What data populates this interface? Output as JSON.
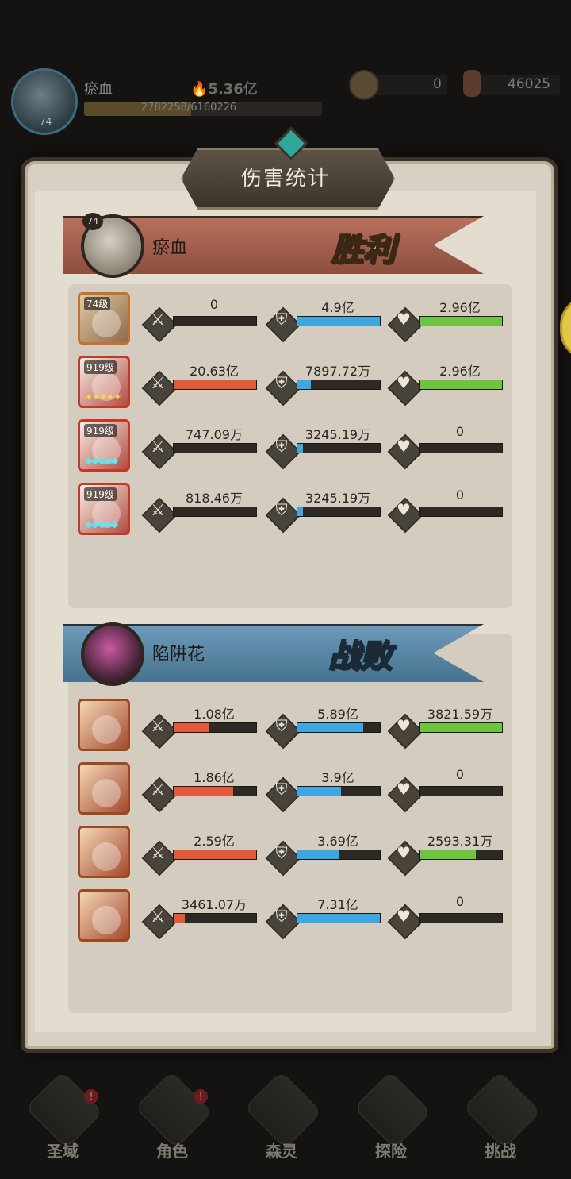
{
  "hud": {
    "player_name": "瘀血",
    "player_level": "74",
    "power": "5.36亿",
    "exp_text": "2782258/6160226",
    "exp_fraction": 0.45,
    "coins": "0",
    "gems": "46025"
  },
  "panel": {
    "title": "伤害统计"
  },
  "teams": [
    {
      "name": "瘀血",
      "level": "74",
      "result": "胜利",
      "heroes": [
        {
          "level": "74级",
          "stars": "",
          "star_color": "",
          "damage": "0",
          "damage_fill": 0.0,
          "taken": "4.9亿",
          "taken_fill": 1.0,
          "heal": "2.96亿",
          "heal_fill": 1.0
        },
        {
          "level": "919级",
          "stars": "✦✦✦✦✦",
          "star_color": "gold",
          "damage": "20.63亿",
          "damage_fill": 1.0,
          "taken": "7897.72万",
          "taken_fill": 0.16,
          "heal": "2.96亿",
          "heal_fill": 1.0
        },
        {
          "level": "919级",
          "stars": "◆◆◆◆◆",
          "star_color": "cyan",
          "damage": "747.09万",
          "damage_fill": 0.0,
          "taken": "3245.19万",
          "taken_fill": 0.07,
          "heal": "0",
          "heal_fill": 0.0
        },
        {
          "level": "919级",
          "stars": "◆◆◆◆◆",
          "star_color": "cyan",
          "damage": "818.46万",
          "damage_fill": 0.0,
          "taken": "3245.19万",
          "taken_fill": 0.07,
          "heal": "0",
          "heal_fill": 0.0
        }
      ]
    },
    {
      "name": "陷阱花",
      "level": "",
      "result": "战败",
      "heroes": [
        {
          "level": "",
          "stars": "",
          "star_color": "",
          "damage": "1.08亿",
          "damage_fill": 0.42,
          "taken": "5.89亿",
          "taken_fill": 0.8,
          "heal": "3821.59万",
          "heal_fill": 1.0
        },
        {
          "level": "",
          "stars": "",
          "star_color": "",
          "damage": "1.86亿",
          "damage_fill": 0.72,
          "taken": "3.9亿",
          "taken_fill": 0.53,
          "heal": "0",
          "heal_fill": 0.0
        },
        {
          "level": "",
          "stars": "",
          "star_color": "",
          "damage": "2.59亿",
          "damage_fill": 1.0,
          "taken": "3.69亿",
          "taken_fill": 0.5,
          "heal": "2593.31万",
          "heal_fill": 0.68
        },
        {
          "level": "",
          "stars": "",
          "star_color": "",
          "damage": "3461.07万",
          "damage_fill": 0.13,
          "taken": "7.31亿",
          "taken_fill": 1.0,
          "heal": "0",
          "heal_fill": 0.0
        }
      ]
    }
  ],
  "stat_icons": {
    "damage": "sword-icon",
    "taken": "shield-icon",
    "heal": "heart-plus-icon"
  },
  "colors": {
    "damage_bar": "#e25a3a",
    "taken_bar": "#3ea7de",
    "heal_bar": "#6dc43f"
  },
  "bottom_nav": [
    {
      "label": "圣域",
      "badge": "!"
    },
    {
      "label": "角色",
      "badge": "!"
    },
    {
      "label": "森灵",
      "badge": ""
    },
    {
      "label": "探险",
      "badge": ""
    },
    {
      "label": "挑战",
      "badge": ""
    }
  ]
}
